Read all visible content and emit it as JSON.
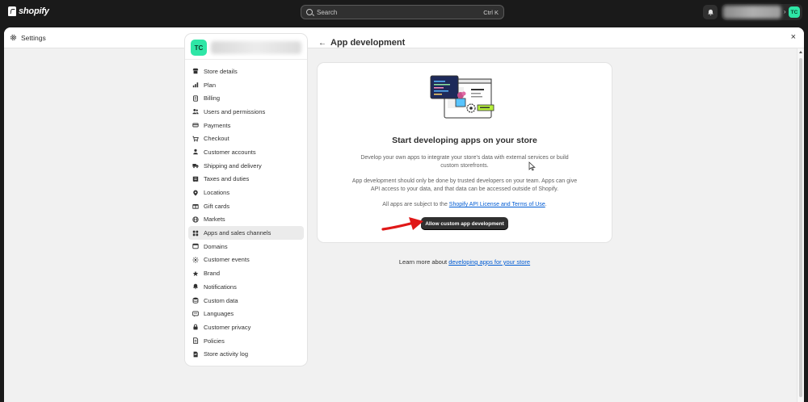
{
  "topbar": {
    "brand": "shopify",
    "search_placeholder": "Search",
    "search_shortcut": "Ctrl K",
    "store_initials": "TC"
  },
  "window": {
    "title": "Settings",
    "close_label": "×"
  },
  "sidebar": {
    "store_initials": "TC",
    "items": [
      {
        "label": "Store details",
        "icon": "store-icon"
      },
      {
        "label": "Plan",
        "icon": "plan-icon"
      },
      {
        "label": "Billing",
        "icon": "billing-icon"
      },
      {
        "label": "Users and permissions",
        "icon": "users-icon"
      },
      {
        "label": "Payments",
        "icon": "payments-icon"
      },
      {
        "label": "Checkout",
        "icon": "cart-icon"
      },
      {
        "label": "Customer accounts",
        "icon": "person-icon"
      },
      {
        "label": "Shipping and delivery",
        "icon": "truck-icon"
      },
      {
        "label": "Taxes and duties",
        "icon": "taxes-icon"
      },
      {
        "label": "Locations",
        "icon": "location-icon"
      },
      {
        "label": "Gift cards",
        "icon": "gift-icon"
      },
      {
        "label": "Markets",
        "icon": "globe-icon"
      },
      {
        "label": "Apps and sales channels",
        "icon": "apps-icon"
      },
      {
        "label": "Domains",
        "icon": "domain-icon"
      },
      {
        "label": "Customer events",
        "icon": "events-icon"
      },
      {
        "label": "Brand",
        "icon": "brand-icon"
      },
      {
        "label": "Notifications",
        "icon": "bell-icon"
      },
      {
        "label": "Custom data",
        "icon": "database-icon"
      },
      {
        "label": "Languages",
        "icon": "language-icon"
      },
      {
        "label": "Customer privacy",
        "icon": "lock-icon"
      },
      {
        "label": "Policies",
        "icon": "policy-icon"
      },
      {
        "label": "Store activity log",
        "icon": "activity-icon"
      }
    ],
    "active_index": 12
  },
  "main": {
    "title": "App development",
    "card": {
      "heading": "Start developing apps on your store",
      "paragraph1": "Develop your own apps to integrate your store's data with external services or build custom storefronts.",
      "paragraph2": "App development should only be done by trusted developers on your team. Apps can give API access to your data, and that data can be accessed outside of Shopify.",
      "paragraph3_prefix": "All apps are subject to the ",
      "paragraph3_link": "Shopify API License and Terms of Use",
      "paragraph3_suffix": ".",
      "button_label": "Allow custom app development"
    },
    "learn_more_prefix": "Learn more about ",
    "learn_more_link": "developing apps for your store"
  },
  "colors": {
    "accent_green": "#2ee6a6",
    "link_blue": "#005bd3",
    "annotation_red": "#e01818",
    "button_dark": "#303030"
  }
}
